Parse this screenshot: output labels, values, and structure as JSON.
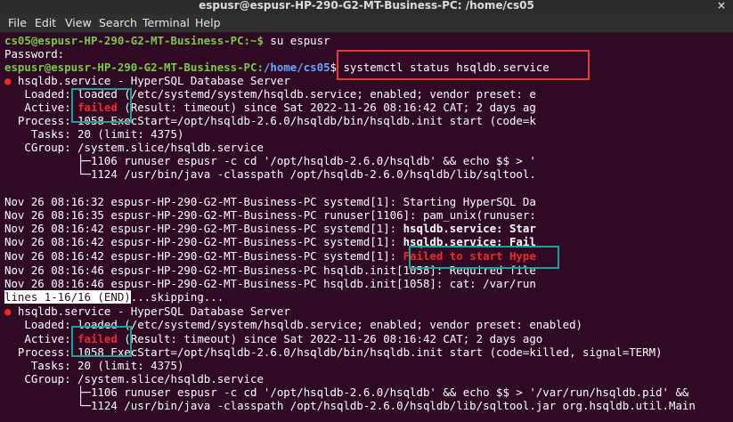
{
  "window": {
    "title": "espusr@espusr-HP-290-G2-MT-Business-PC: /home/cs05",
    "close_glyph": "×"
  },
  "menu": [
    "File",
    "Edit",
    "View",
    "Search",
    "Terminal",
    "Help"
  ],
  "terminal": {
    "l1_prompt": "cs05@espusr-HP-290-G2-MT-Business-PC:~$",
    "l1_cmd": " su espusr",
    "l2": "Password:",
    "l3_user": "espusr@espusr-HP-290-G2-MT-Business-PC:",
    "l3_path": "/home/cs05",
    "l3_cmd": "$ systemctl status hsqldb.service",
    "dot": "●",
    "unit1_header": " hsqldb.service - HyperSQL Database Server",
    "unit1_loaded": "   Loaded: loaded (/etc/systemd/system/hsqldb.service; enabled; vendor preset: e",
    "active_label": "   Active: ",
    "failed": "failed",
    "unit1_active_rest": " (Result: timeout) since Sat 2022-11-26 08:16:42 CAT; 2 days ag",
    "unit1_process": "  Process: 1058 ExecStart=/opt/hsqldb-2.6.0/hsqldb/bin/hsqldb.init start (code=k",
    "tasks": "    Tasks: 20 (limit: 4375)",
    "cgroup": "   CGroup: /system.slice/hsqldb.service",
    "unit1_cg1": "           ├─1106 runuser espusr -c cd '/opt/hsqldb-2.6.0/hsqldb' && echo $$ > '",
    "unit1_cg2": "           └─1124 /usr/bin/java -classpath /opt/hsqldb-2.6.0/hsqldb/lib/sqltool.",
    "log1": "Nov 26 08:16:32 espusr-HP-290-G2-MT-Business-PC systemd[1]: Starting HyperSQL Da",
    "log2": "Nov 26 08:16:35 espusr-HP-290-G2-MT-Business-PC runuser[1106]: pam_unix(runuser:",
    "log3_pre": "Nov 26 08:16:42 espusr-HP-290-G2-MT-Business-PC systemd[1]: ",
    "log3_bold": "hsqldb.service: Star",
    "log4_pre": "Nov 26 08:16:42 espusr-HP-290-G2-MT-Business-PC systemd[1]: ",
    "log4_bold": "hsqldb.service: Fail",
    "log5_pre": "Nov 26 08:16:42 espusr-HP-290-G2-MT-Business-PC systemd[1]: ",
    "log5_red": "Failed to start Hype",
    "log6": "Nov 26 08:16:46 espusr-HP-290-G2-MT-Business-PC hsqldb.init[1058]: Required file",
    "log7": "Nov 26 08:16:46 espusr-HP-290-G2-MT-Business-PC hsqldb.init[1058]: cat: /var/run",
    "pager": "lines 1-16/16 (END)",
    "skipping": "...skipping...",
    "unit2_header": " hsqldb.service - HyperSQL Database Server",
    "unit2_loaded": "   Loaded: loaded (/etc/systemd/system/hsqldb.service; enabled; vendor preset: enabled)",
    "unit2_active_rest": " (Result: timeout) since Sat 2022-11-26 08:16:42 CAT; 2 days ago",
    "unit2_process": "  Process: 1058 ExecStart=/opt/hsqldb-2.6.0/hsqldb/bin/hsqldb.init start (code=killed, signal=TERM)",
    "unit2_cg1": "           ├─1106 runuser espusr -c cd '/opt/hsqldb-2.6.0/hsqldb' && echo $$ > '/var/run/hsqldb.pid' &&",
    "unit2_cg2": "           └─1124 /usr/bin/java -classpath /opt/hsqldb-2.6.0/hsqldb/lib/sqltool.jar org.hsqldb.util.Main"
  },
  "colors": {
    "background": "#300a24",
    "prompt_user": "#7ac943",
    "prompt_path": "#6aa7ff",
    "failed_red": "#ef2929",
    "highlight_red_box": "#e03c3c",
    "highlight_teal_box": "#1aa39a"
  }
}
